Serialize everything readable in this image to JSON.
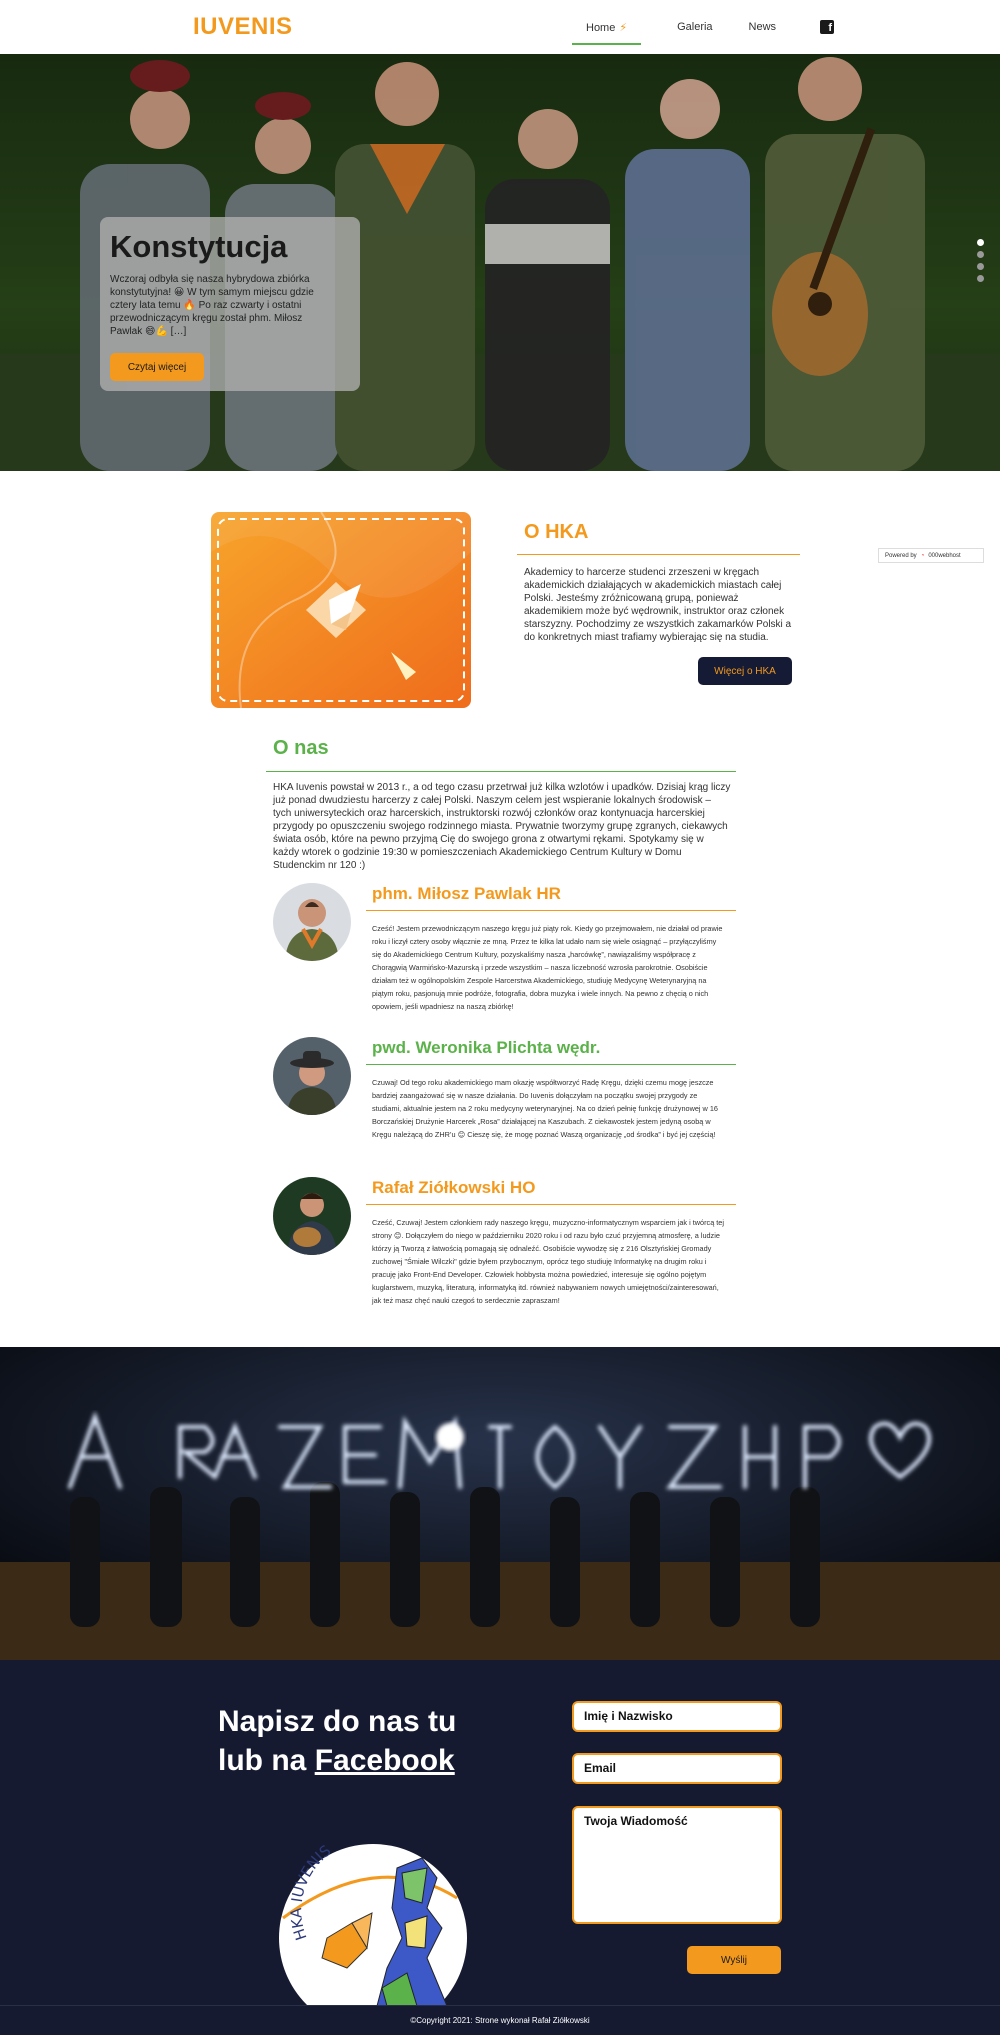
{
  "nav": {
    "brand": "IUVENIS",
    "links": [
      "Home",
      "Galeria",
      "News"
    ],
    "home_icon": "bolt-icon",
    "facebook_icon": "facebook-icon"
  },
  "hero": {
    "title": "Konstytucja",
    "text": "Wczoraj odbyła się nasza hybrydowa zbiórka konstytutyjna! 😀 W tym samym miejscu gdzie cztery lata temu 🔥 Po raz czwarty i ostatni przewodniczącym kręgu został phm. Miłosz Pawlak 😄💪 […]",
    "button": "Czytaj więcej",
    "slides": 4,
    "active_slide": 1
  },
  "about_hka": {
    "heading": "O HKA",
    "text": "Akademicy to harcerze studenci zrzeszeni w kręgach akademickich działających w akademickich miastach całej Polski. Jesteśmy zróżnicowaną grupą, ponieważ akademikiem może być wędrownik, instruktor oraz członek starszyzny. Pochodzimy ze wszystkich zakamarków Polski a do konkretnych miast trafiamy wybierając się na studia.",
    "button": "Więcej o HKA"
  },
  "powered": {
    "label": "Powered by",
    "host": "000webhost"
  },
  "about_us": {
    "heading": "O nas",
    "text": "HKA Iuvenis powstał w 2013 r., a od tego czasu przetrwał już kilka wzlotów i upadków. Dzisiaj krąg liczy już ponad dwudziestu harcerzy z całej Polski. Naszym celem jest wspieranie lokalnych środowisk – tych uniwersyteckich oraz harcerskich, instruktorski rozwój członków oraz kontynuacja harcerskiej przygody po opuszczeniu swojego rodzinnego miasta. Prywatnie tworzymy grupę zgranych, ciekawych świata osób, które na pewno przyjmą Cię do swojego grona z otwartymi rękami. Spotykamy się w każdy wtorek o godzinie 19:30 w pomieszczeniach Akademickiego Centrum Kultury w Domu Studenckim nr 120 :)"
  },
  "members": [
    {
      "name": "phm. Miłosz Pawlak HR",
      "color": "#f39a1e",
      "text": "Cześć! Jestem przewodniczącym naszego kręgu już piąty rok. Kiedy go przejmowałem, nie działał od prawie roku i liczył cztery osoby włącznie ze mną. Przez te kilka lat udało nam się wiele osiągnąć – przyłączyliśmy się do Akademickiego Centrum Kultury, pozyskaliśmy nasza „harcówkę”, nawiązaliśmy współpracę z Chorągwią Warmińsko-Mazurską i przede wszystkim – nasza liczebność wzrosła parokrotnie. Osobiście działam też w ogólnopolskim Zespole Harcerstwa Akademickiego, studiuję Medycynę Weterynaryjną na piątym roku, pasjonują mnie podróże, fotografia, dobra muzyka i wiele innych. Na pewno z chęcią o nich opowiem, jeśli wpadniesz na naszą zbiórkę!"
    },
    {
      "name": "pwd. Weronika Plichta wędr.",
      "color": "#5bb24a",
      "text": "Czuwaj! Od tego roku akademickiego mam okazję współtworzyć Radę Kręgu, dzięki czemu mogę jeszcze bardziej zaangażować się w nasze działania. Do Iuvenis dołączyłam na początku swojej przygody ze studiami, aktualnie jestem na 2 roku medycyny weterynaryjnej. Na co dzień pełnię funkcję drużynowej w 16 Borczańskiej Drużynie Harcerek „Rosa” działającej na Kaszubach. Z ciekawostek jestem jedyną osobą w Kręgu należącą do ZHR’u 😊 Cieszę się, że mogę poznać Waszą organizację „od środka” i być jej częścią!"
    },
    {
      "name": "Rafał Ziółkowski HO",
      "color": "#f39a1e",
      "text": "Cześć, Czuwaj! Jestem członkiem rady naszego kręgu, muzyczno-informatycznym wsparciem jak i twórcą tej strony 😊. Dołączyłem do niego w październiku 2020 roku i od razu było czuć przyjemną atmosferę, a ludzie którzy ją Tworzą z łatwością pomagają się odnaleźć. Osobiście wywodzę się z 216 Olsztyńskiej Gromady zuchowej \"Śmiałe Wilczki\" gdzie byłem przybocznym, oprócz tego studiuję Informatykę na drugim roku i pracuję jako Front-End Developer. Człowiek hobbysta można powiedzieć, interesuje się ogólno pojętym kuglarstwem, muzyką, literaturą, informatyką itd. również nabywaniem nowych umiejętności/zainteresowań, jak też masz chęć nauki czegoś to serdecznie zapraszam!"
    }
  ],
  "lights_photo": {
    "letters": [
      "A",
      "RAZEM",
      "JOY",
      "ZHP",
      "♡"
    ]
  },
  "contact": {
    "heading_line1": "Napisz do nas tu",
    "heading_line2_prefix": "lub na",
    "heading_link": "Facebook",
    "name_placeholder": "Imię i Nazwisko",
    "email_placeholder": "Email",
    "message_placeholder": "Twoja Wiadomość",
    "send": "Wyślij",
    "logo_text": "HKA IUVENIS"
  },
  "footer": {
    "copyright": "©Copyright 2021: Strone wykonał Rafał Ziółkowski"
  },
  "colors": {
    "accent_orange": "#f39a1e",
    "accent_green": "#5bb24a",
    "navy": "#151a31"
  }
}
